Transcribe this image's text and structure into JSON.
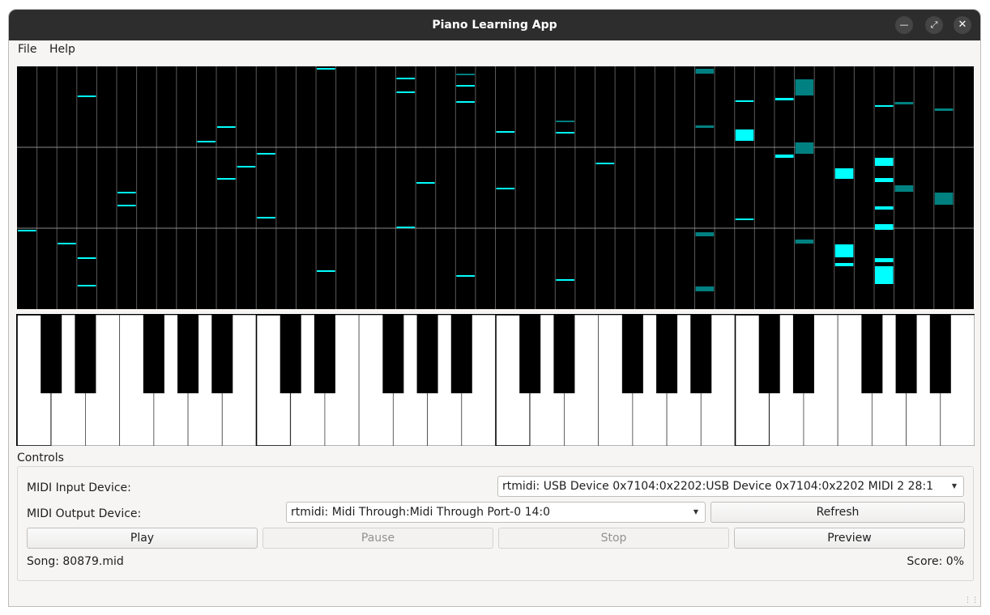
{
  "window": {
    "title": "Piano Learning App"
  },
  "menu": {
    "file": "File",
    "help": "Help"
  },
  "controls": {
    "group_label": "Controls",
    "midi_input_label": "MIDI Input Device:",
    "midi_input_value": "rtmidi: USB Device 0x7104:0x2202:USB Device 0x7104:0x2202 MIDI 2 28:1",
    "midi_output_label": "MIDI Output Device:",
    "midi_output_value": "rtmidi: Midi Through:Midi Through Port-0 14:0",
    "refresh": "Refresh",
    "play": "Play",
    "pause": "Pause",
    "stop": "Stop",
    "preview": "Preview",
    "song": "Song: 80879.mid",
    "score": "Score: 0%"
  },
  "colors": {
    "note_active": "#00ffff",
    "note_dim": "#008080",
    "roll_bg": "#000000"
  }
}
